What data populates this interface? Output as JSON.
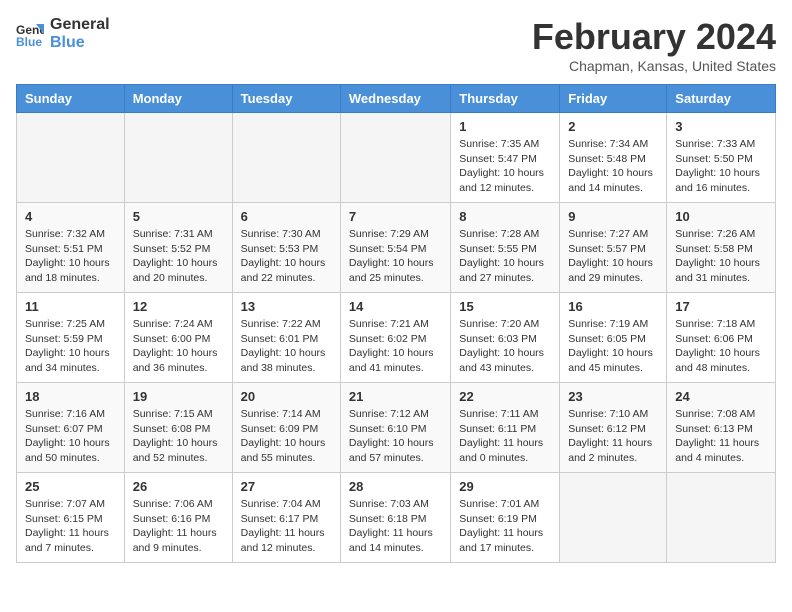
{
  "header": {
    "logo_line1": "General",
    "logo_line2": "Blue",
    "month_title": "February 2024",
    "location": "Chapman, Kansas, United States"
  },
  "days_of_week": [
    "Sunday",
    "Monday",
    "Tuesday",
    "Wednesday",
    "Thursday",
    "Friday",
    "Saturday"
  ],
  "weeks": [
    [
      {
        "day": "",
        "detail": ""
      },
      {
        "day": "",
        "detail": ""
      },
      {
        "day": "",
        "detail": ""
      },
      {
        "day": "",
        "detail": ""
      },
      {
        "day": "1",
        "detail": "Sunrise: 7:35 AM\nSunset: 5:47 PM\nDaylight: 10 hours\nand 12 minutes."
      },
      {
        "day": "2",
        "detail": "Sunrise: 7:34 AM\nSunset: 5:48 PM\nDaylight: 10 hours\nand 14 minutes."
      },
      {
        "day": "3",
        "detail": "Sunrise: 7:33 AM\nSunset: 5:50 PM\nDaylight: 10 hours\nand 16 minutes."
      }
    ],
    [
      {
        "day": "4",
        "detail": "Sunrise: 7:32 AM\nSunset: 5:51 PM\nDaylight: 10 hours\nand 18 minutes."
      },
      {
        "day": "5",
        "detail": "Sunrise: 7:31 AM\nSunset: 5:52 PM\nDaylight: 10 hours\nand 20 minutes."
      },
      {
        "day": "6",
        "detail": "Sunrise: 7:30 AM\nSunset: 5:53 PM\nDaylight: 10 hours\nand 22 minutes."
      },
      {
        "day": "7",
        "detail": "Sunrise: 7:29 AM\nSunset: 5:54 PM\nDaylight: 10 hours\nand 25 minutes."
      },
      {
        "day": "8",
        "detail": "Sunrise: 7:28 AM\nSunset: 5:55 PM\nDaylight: 10 hours\nand 27 minutes."
      },
      {
        "day": "9",
        "detail": "Sunrise: 7:27 AM\nSunset: 5:57 PM\nDaylight: 10 hours\nand 29 minutes."
      },
      {
        "day": "10",
        "detail": "Sunrise: 7:26 AM\nSunset: 5:58 PM\nDaylight: 10 hours\nand 31 minutes."
      }
    ],
    [
      {
        "day": "11",
        "detail": "Sunrise: 7:25 AM\nSunset: 5:59 PM\nDaylight: 10 hours\nand 34 minutes."
      },
      {
        "day": "12",
        "detail": "Sunrise: 7:24 AM\nSunset: 6:00 PM\nDaylight: 10 hours\nand 36 minutes."
      },
      {
        "day": "13",
        "detail": "Sunrise: 7:22 AM\nSunset: 6:01 PM\nDaylight: 10 hours\nand 38 minutes."
      },
      {
        "day": "14",
        "detail": "Sunrise: 7:21 AM\nSunset: 6:02 PM\nDaylight: 10 hours\nand 41 minutes."
      },
      {
        "day": "15",
        "detail": "Sunrise: 7:20 AM\nSunset: 6:03 PM\nDaylight: 10 hours\nand 43 minutes."
      },
      {
        "day": "16",
        "detail": "Sunrise: 7:19 AM\nSunset: 6:05 PM\nDaylight: 10 hours\nand 45 minutes."
      },
      {
        "day": "17",
        "detail": "Sunrise: 7:18 AM\nSunset: 6:06 PM\nDaylight: 10 hours\nand 48 minutes."
      }
    ],
    [
      {
        "day": "18",
        "detail": "Sunrise: 7:16 AM\nSunset: 6:07 PM\nDaylight: 10 hours\nand 50 minutes."
      },
      {
        "day": "19",
        "detail": "Sunrise: 7:15 AM\nSunset: 6:08 PM\nDaylight: 10 hours\nand 52 minutes."
      },
      {
        "day": "20",
        "detail": "Sunrise: 7:14 AM\nSunset: 6:09 PM\nDaylight: 10 hours\nand 55 minutes."
      },
      {
        "day": "21",
        "detail": "Sunrise: 7:12 AM\nSunset: 6:10 PM\nDaylight: 10 hours\nand 57 minutes."
      },
      {
        "day": "22",
        "detail": "Sunrise: 7:11 AM\nSunset: 6:11 PM\nDaylight: 11 hours\nand 0 minutes."
      },
      {
        "day": "23",
        "detail": "Sunrise: 7:10 AM\nSunset: 6:12 PM\nDaylight: 11 hours\nand 2 minutes."
      },
      {
        "day": "24",
        "detail": "Sunrise: 7:08 AM\nSunset: 6:13 PM\nDaylight: 11 hours\nand 4 minutes."
      }
    ],
    [
      {
        "day": "25",
        "detail": "Sunrise: 7:07 AM\nSunset: 6:15 PM\nDaylight: 11 hours\nand 7 minutes."
      },
      {
        "day": "26",
        "detail": "Sunrise: 7:06 AM\nSunset: 6:16 PM\nDaylight: 11 hours\nand 9 minutes."
      },
      {
        "day": "27",
        "detail": "Sunrise: 7:04 AM\nSunset: 6:17 PM\nDaylight: 11 hours\nand 12 minutes."
      },
      {
        "day": "28",
        "detail": "Sunrise: 7:03 AM\nSunset: 6:18 PM\nDaylight: 11 hours\nand 14 minutes."
      },
      {
        "day": "29",
        "detail": "Sunrise: 7:01 AM\nSunset: 6:19 PM\nDaylight: 11 hours\nand 17 minutes."
      },
      {
        "day": "",
        "detail": ""
      },
      {
        "day": "",
        "detail": ""
      }
    ]
  ]
}
